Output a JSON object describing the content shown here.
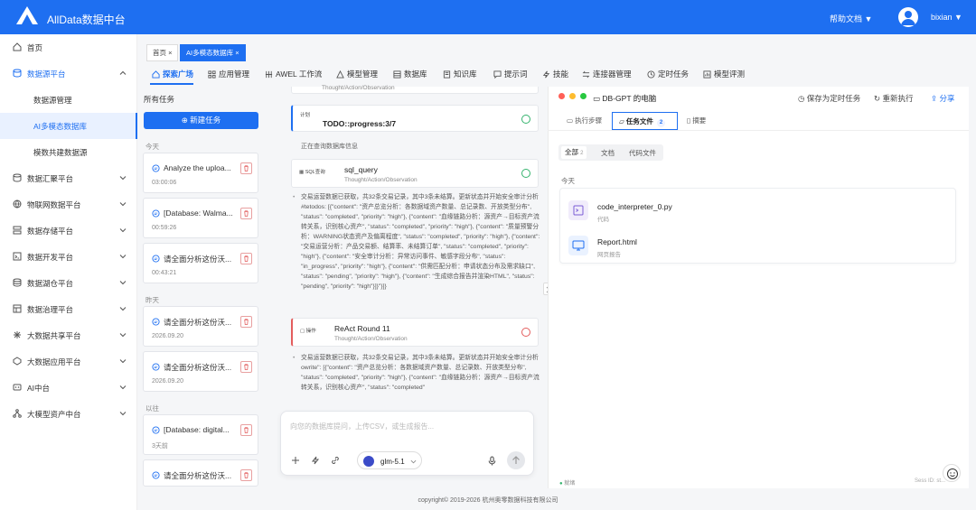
{
  "app": {
    "title": "AllData数据中台",
    "help_label": "帮助文档",
    "username": "bixian"
  },
  "sidebar": {
    "items": [
      {
        "label": "首页",
        "icon": "home-icon"
      },
      {
        "label": "数据源平台",
        "icon": "database-icon",
        "expanded": true,
        "children": [
          {
            "label": "数据源管理"
          },
          {
            "label": "AI多模态数据库",
            "active": true
          },
          {
            "label": "模数共建数据源"
          }
        ]
      },
      {
        "label": "数据汇聚平台",
        "icon": "db-icon"
      },
      {
        "label": "物联网数据平台",
        "icon": "globe-icon"
      },
      {
        "label": "数据存储平台",
        "icon": "storage-icon"
      },
      {
        "label": "数据开发平台",
        "icon": "dev-icon"
      },
      {
        "label": "数据湖仓平台",
        "icon": "lake-icon"
      },
      {
        "label": "数据治理平台",
        "icon": "governance-icon"
      },
      {
        "label": "大数据共享平台",
        "icon": "share-icon"
      },
      {
        "label": "大数据应用平台",
        "icon": "app-icon"
      },
      {
        "label": "AI中台",
        "icon": "ai-icon"
      },
      {
        "label": "大模型资产中台",
        "icon": "model-icon"
      }
    ]
  },
  "tags": [
    {
      "label": "首页"
    },
    {
      "label": "AI多模态数据库",
      "active": true
    }
  ],
  "tabs": [
    {
      "label": "探索广场",
      "active": true
    },
    {
      "label": "应用管理"
    },
    {
      "label": "AWEL 工作流"
    },
    {
      "label": "模型管理"
    },
    {
      "label": "数据库"
    },
    {
      "label": "知识库"
    },
    {
      "label": "提示词"
    },
    {
      "label": "技能"
    },
    {
      "label": "连接器管理"
    },
    {
      "label": "定时任务"
    },
    {
      "label": "模型评测"
    }
  ],
  "tasks_panel": {
    "title": "所有任务",
    "new_task_label": "新建任务",
    "groups": [
      {
        "label": "今天",
        "items": [
          {
            "title": "Analyze the uploa...",
            "time": "03:00:06"
          },
          {
            "title": "[Database: Walma...",
            "time": "00:59:26"
          },
          {
            "title": "请全面分析这份沃...",
            "time": "00:43:21"
          }
        ]
      },
      {
        "label": "昨天",
        "items": [
          {
            "title": "请全面分析这份沃...",
            "time": "2026.09.20"
          },
          {
            "title": "请全面分析这份沃...",
            "time": "2026.09.20"
          }
        ]
      },
      {
        "label": "以往",
        "items": [
          {
            "title": "[Database: digital...",
            "time": "3天前"
          },
          {
            "title": "请全面分析这份沃...",
            "time": ""
          }
        ]
      }
    ]
  },
  "chat": {
    "top_sub": "Thought/Action/Observation",
    "plan_badge": "计划",
    "plan_title": "TODO::progress:3/7",
    "note1": "正在查询数据库信息",
    "sql_badge": "SQL查询",
    "sql_title": "sql_query",
    "sql_sub": "Thought/Action/Observation",
    "para1": "交易运营数据已获取，共32条交易记录，其中3条未结算。更新状态并开始安全审计分析#tetodos: [{\"content\": \"资产总览分析：各数据域资产数量、总记录数、开放类型分布\", \"status\": \"completed\", \"priority\": \"high\"}, {\"content\": \"血缘链路分析：源资产→目标资产流转关系，识别核心资产\", \"status\": \"completed\", \"priority\": \"high\"}, {\"content\": \"质量预警分析：WARNING状态资产及偏离程度\", \"status\": \"completed\", \"priority\": \"high\"}, {\"content\": \"交易运营分析：产品交易额、结算率、未结算订单\", \"status\": \"completed\", \"priority\": \"high\"}, {\"content\": \"安全审计分析：异常访问事件、敏感字段分布\", \"status\": \"in_progress\", \"priority\": \"high\"}, {\"content\": \"供需匹配分析：申请状态分布及需求缺口\", \"status\": \"pending\", \"priority\": \"high\"}, {\"content\": \"生成综合报告并渲染HTML\", \"status\": \"pending\", \"priority\": \"high\"}]}\"}]}",
    "op_badge": "操作",
    "op_title": "ReAct Round 11",
    "op_sub": "Thought/Action/Observation",
    "para2": "交易运营数据已获取，共32条交易记录，其中3条未结算。更新状态并开始安全审计分析owrite\": [{\"content\": \"资产总览分析：各数据域资产数量、总记录数、开放类型分布\", \"status\": \"completed\", \"priority\": \"high\"}, {\"content\": \"血缘链路分析：源资产→目标资产流转关系，识别核心资产\", \"status\": \"completed\"",
    "input_placeholder": "向您的数据库提问，上传CSV，或生成报告...",
    "model_label": "glm-5.1"
  },
  "right_panel": {
    "title": "DB-GPT 的电脑",
    "save_label": "保存为定时任务",
    "rerun_label": "重新执行",
    "share_label": "分享",
    "tabs": [
      {
        "label": "执行步骤"
      },
      {
        "label": "任务文件",
        "count": "2",
        "active": true
      },
      {
        "label": "摘要"
      }
    ],
    "filters": [
      {
        "label": "全部",
        "count": "2",
        "active": true
      },
      {
        "label": "文档"
      },
      {
        "label": "代码文件"
      }
    ],
    "group_label": "今天",
    "files": [
      {
        "name": "code_interpreter_0.py",
        "kind": "代码"
      },
      {
        "name": "Report.html",
        "kind": "网页报告"
      }
    ],
    "status": "就绪",
    "session": "Sess ID: st..."
  },
  "footer": "copyright© 2019-2026 杭州奥零数据科技有限公司",
  "colors": {
    "primary": "#1e6ff1",
    "success": "#34b36d",
    "danger": "#e35d5d"
  }
}
